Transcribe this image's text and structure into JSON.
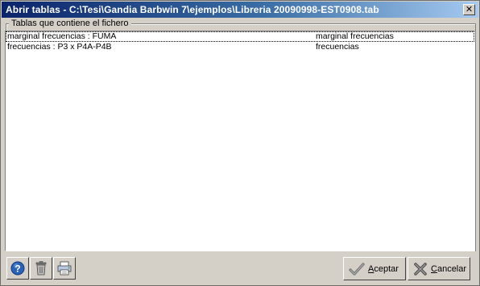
{
  "window": {
    "title": "Abrir tablas - C:\\Tesi\\Gandia Barbwin 7\\ejemplos\\Libreria 20090998-EST0908.tab",
    "close_glyph": "✕"
  },
  "tables_group": {
    "label": "Tablas que contiene el fichero",
    "rows": [
      {
        "name": "marginal frecuencias : FUMA",
        "type": "marginal frecuencias"
      },
      {
        "name": "frecuencias : P3 x P4A-P4B",
        "type": "frecuencias"
      }
    ]
  },
  "toolbar": {
    "help_icon": "help-icon",
    "delete_icon": "trash-icon",
    "print_icon": "printer-icon"
  },
  "buttons": {
    "accept": {
      "mnemonic": "A",
      "rest": "ceptar",
      "icon": "checkmark-icon"
    },
    "cancel": {
      "mnemonic": "C",
      "rest": "ancelar",
      "icon": "cross-icon"
    }
  },
  "colors": {
    "title_start": "#0a246a",
    "title_end": "#a6caf0",
    "face": "#d4d0c8",
    "help_blue": "#2a62b8"
  }
}
